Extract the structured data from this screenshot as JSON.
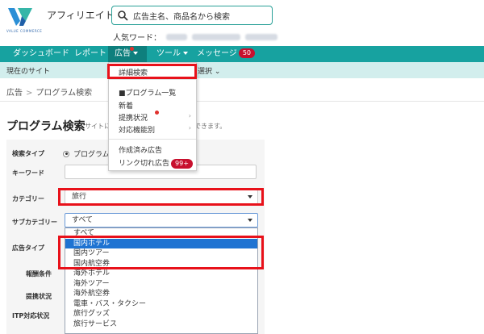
{
  "header": {
    "brand": "アフィリエイト",
    "logo_sub": "VALUE COMMERCE",
    "search_placeholder": "広告主名、商品名から検索",
    "popular_label": "人気ワード：",
    "popular_blurred": [
      "xxxxx",
      "xxxxxxxxxx",
      "xxxxxxx"
    ]
  },
  "nav": {
    "items": [
      {
        "label": "ダッシュボード"
      },
      {
        "label": "レポート"
      },
      {
        "label": "広告"
      },
      {
        "label": "ツール"
      },
      {
        "label": "メッセージ"
      }
    ],
    "message_count": "50"
  },
  "subbar": {
    "current_site": "現在のサイト",
    "select_fragment": "選択"
  },
  "breadcrumb": {
    "parent": "広告",
    "sep": ">",
    "current": "プログラム検索"
  },
  "page": {
    "title": "プログラム検索",
    "subtitle_left": "サイトに",
    "subtitle_right": "索できます。"
  },
  "ad_menu": {
    "advanced_search": "詳細検索",
    "program_list": "■プログラム一覧",
    "new": "新着",
    "partnership_status": "提携状況",
    "supported_features": "対応機能別",
    "created_ads": "作成済み広告",
    "broken_links": "リンク切れ広告",
    "broken_links_count": "99+"
  },
  "form": {
    "search_type_label": "検索タイプ",
    "search_type_value": "プログラム",
    "keyword_label": "キーワード",
    "category_label": "カテゴリー",
    "category_value": "旅行",
    "subcategory_label": "サブカテゴリー",
    "subcategory_value": "すべて",
    "ad_type_label": "広告タイプ",
    "reward_label": "報酬条件",
    "partnership_label": "提携状況",
    "itp_label": "ITP対応状況"
  },
  "subcategory_options": [
    {
      "label": "すべて",
      "highlighted": false
    },
    {
      "label": "国内ホテル",
      "highlighted": true
    },
    {
      "label": "国内ツアー",
      "highlighted": false
    },
    {
      "label": "国内航空券",
      "highlighted": false
    },
    {
      "label": "海外ホテル",
      "highlighted": false
    },
    {
      "label": "海外ツアー",
      "highlighted": false
    },
    {
      "label": "海外航空券",
      "highlighted": false
    },
    {
      "label": "電車・バス・タクシー",
      "highlighted": false
    },
    {
      "label": "旅行グッズ",
      "highlighted": false
    },
    {
      "label": "旅行サービス",
      "highlighted": false
    }
  ],
  "colors": {
    "nav": "#17a2a0",
    "nav_active": "#0e7f7d",
    "highlight": "#e8111a",
    "selection": "#1e73d2"
  }
}
